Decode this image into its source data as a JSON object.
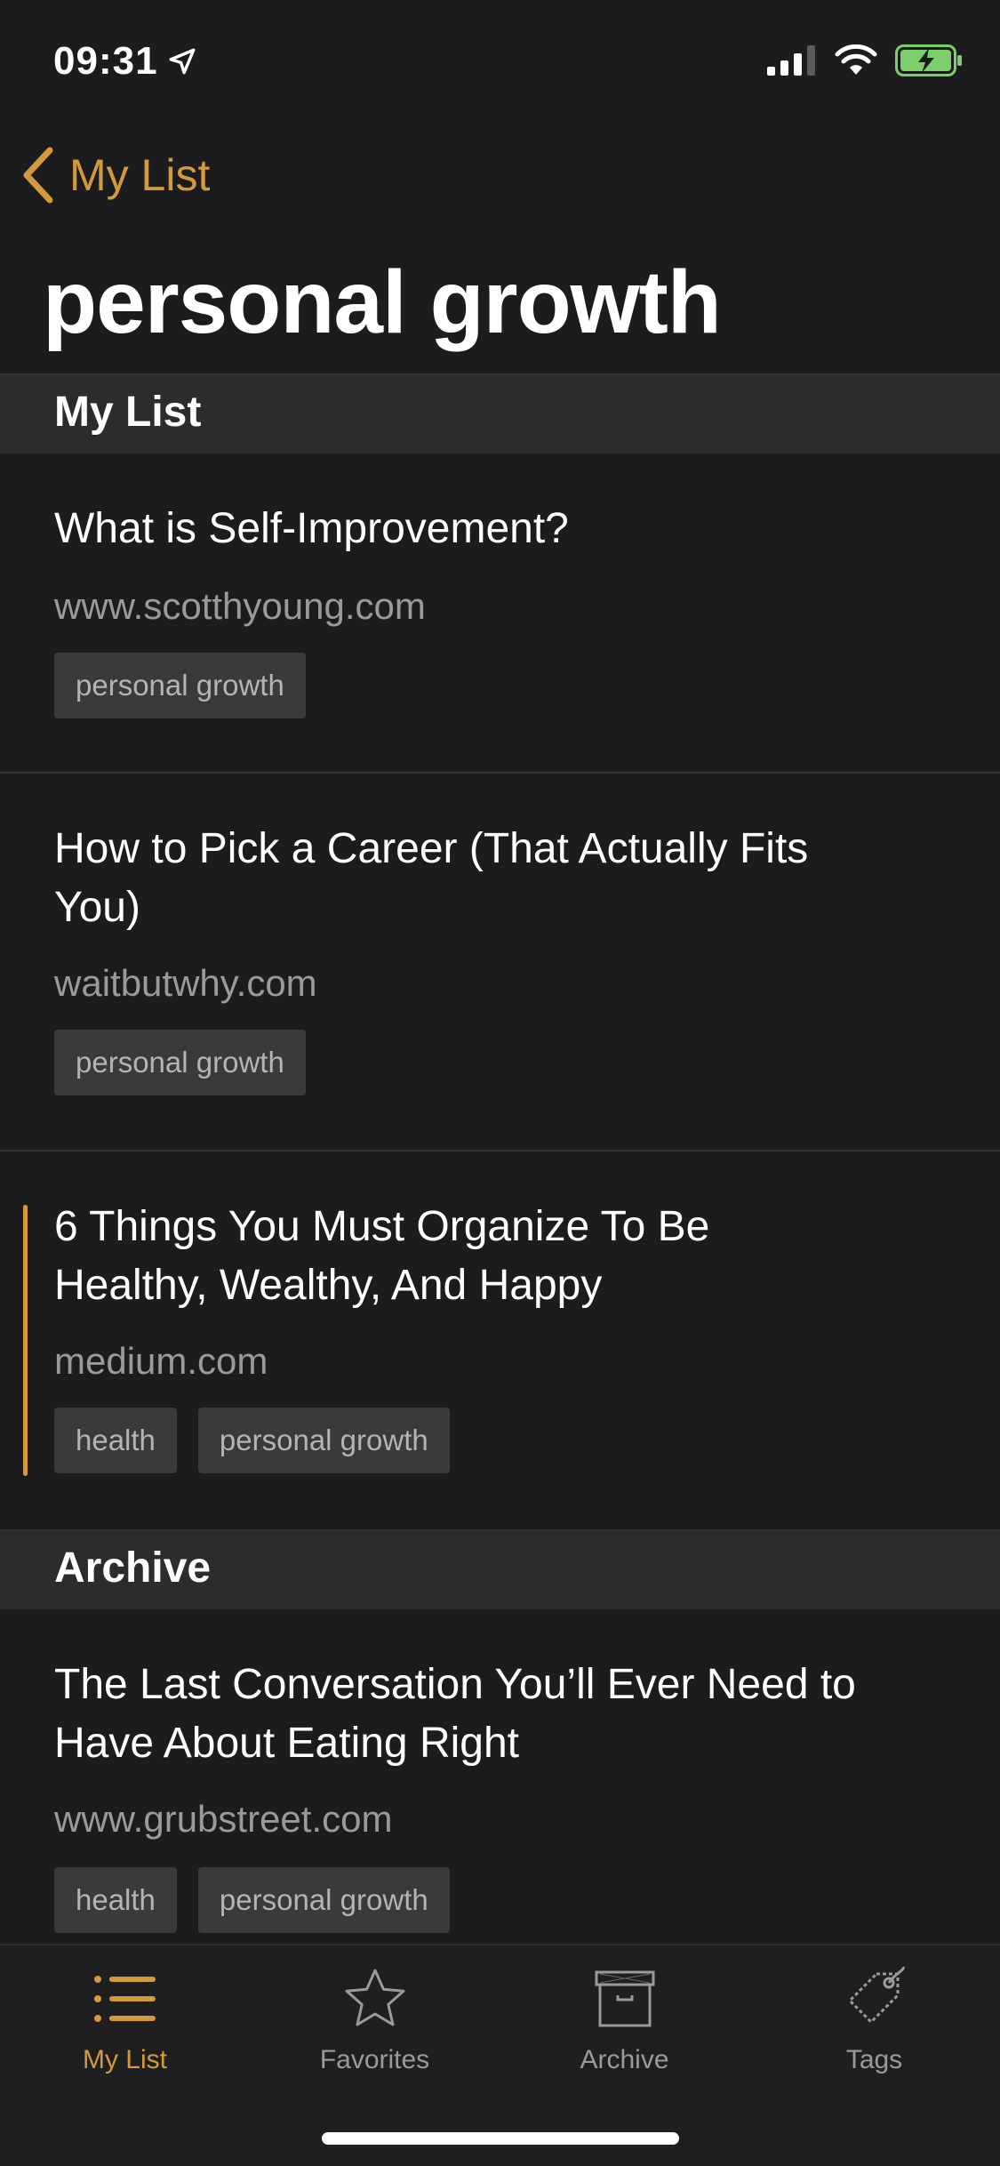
{
  "status_bar": {
    "time": "09:31",
    "icons": [
      "location-arrow-icon",
      "signal-icon",
      "wifi-icon",
      "battery-charging-icon"
    ]
  },
  "nav": {
    "back_label": "My List",
    "title": "personal growth"
  },
  "colors": {
    "accent": "#d29a3c",
    "background": "#1c1c1e",
    "section_header": "#2c2c2e",
    "tag_background": "#3a3a3c",
    "secondary_text": "#9a9a9c"
  },
  "sections": [
    {
      "header": "My List",
      "articles": [
        {
          "title": "What is Self-Improvement?",
          "domain": "www.scotthyoung.com",
          "tags": [
            "personal growth"
          ]
        },
        {
          "title": "How to Pick a Career (That Actually Fits You)",
          "domain": "waitbutwhy.com",
          "tags": [
            "personal growth"
          ]
        },
        {
          "title": "6 Things You Must Organize To Be Healthy, Wealthy, And Happy",
          "domain": "medium.com",
          "tags": [
            "health",
            "personal growth"
          ],
          "highlighted": true
        }
      ]
    },
    {
      "header": "Archive",
      "articles": [
        {
          "title": "The Last Conversation You’ll Ever Need to Have About Eating Right",
          "domain": "www.grubstreet.com",
          "tags": [
            "health",
            "personal growth"
          ]
        }
      ]
    }
  ],
  "tab_bar": {
    "items": [
      {
        "label": "My List",
        "icon": "list-icon",
        "active": true
      },
      {
        "label": "Favorites",
        "icon": "star-icon",
        "active": false
      },
      {
        "label": "Archive",
        "icon": "archive-box-icon",
        "active": false
      },
      {
        "label": "Tags",
        "icon": "tag-icon",
        "active": false
      }
    ]
  }
}
